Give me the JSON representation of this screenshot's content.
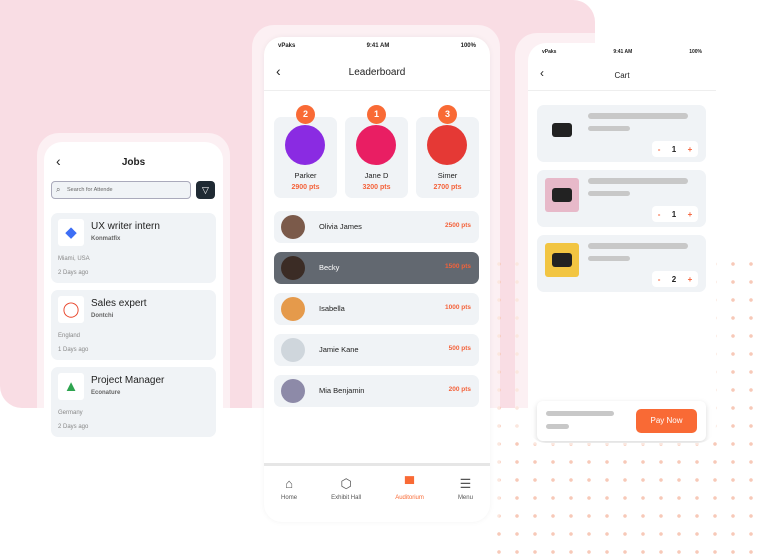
{
  "status": {
    "time": "9:41 AM",
    "battery": "100%",
    "carrier": "vPaks"
  },
  "jobs": {
    "title": "Jobs",
    "search_placeholder": "Search for Attende",
    "items": [
      {
        "title": "UX writer intern",
        "company": "Konmatfix",
        "location": "Miami, USA",
        "posted": "2 Days ago"
      },
      {
        "title": "Sales expert",
        "company": "Dontchi",
        "location": "England",
        "posted": "1 Days ago"
      },
      {
        "title": "Project Manager",
        "company": "Econature",
        "location": "Germany",
        "posted": "2 Days ago"
      }
    ]
  },
  "leaderboard": {
    "title": "Leaderboard",
    "podium": [
      {
        "rank": "2",
        "name": "Parker",
        "points": "2900 pts",
        "color": "#8a2be2"
      },
      {
        "rank": "1",
        "name": "Jane D",
        "points": "3200 pts",
        "color": "#e91e63"
      },
      {
        "rank": "3",
        "name": "Simer",
        "points": "2700 pts",
        "color": "#e53935"
      }
    ],
    "list": [
      {
        "name": "Olivia James",
        "points": "2500 pts"
      },
      {
        "name": "Becky",
        "points": "1500 pts"
      },
      {
        "name": "Isabella",
        "points": "1000 pts"
      },
      {
        "name": "Jamie Kane",
        "points": "500 pts"
      },
      {
        "name": "Mia Benjamin",
        "points": "200 pts"
      }
    ],
    "nav": [
      {
        "label": "Home",
        "icon": "home-icon"
      },
      {
        "label": "Exhibit Hall",
        "icon": "cube-icon"
      },
      {
        "label": "Auditorium",
        "icon": "auditorium-icon"
      },
      {
        "label": "Menu",
        "icon": "menu-icon"
      }
    ]
  },
  "cart": {
    "title": "Cart",
    "items": [
      {
        "qty": "1",
        "minus": "-",
        "plus": "+"
      },
      {
        "qty": "1",
        "minus": "-",
        "plus": "+"
      },
      {
        "qty": "2",
        "minus": "-",
        "plus": "+"
      }
    ],
    "pay_label": "Pay Now"
  },
  "colors": {
    "accent": "#f96a35",
    "pink_bg": "#f9dde4",
    "selected_row": "#626870"
  }
}
